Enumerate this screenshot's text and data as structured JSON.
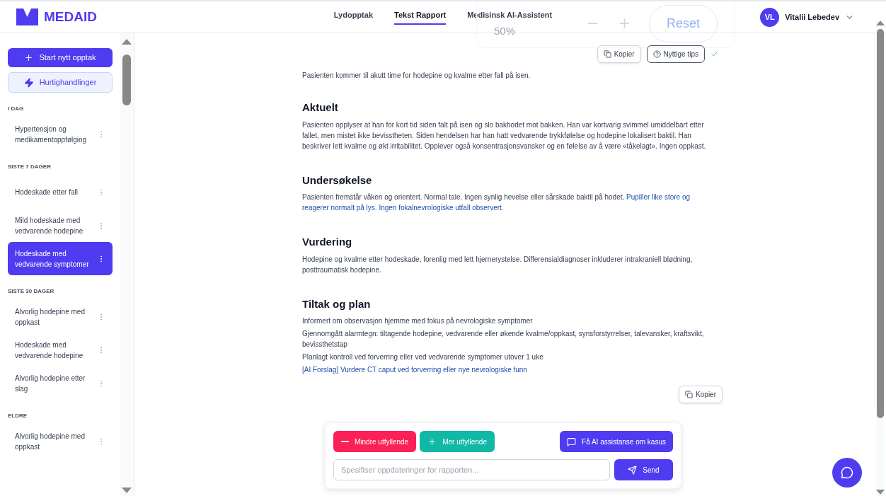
{
  "brand": {
    "name": "MEDAID"
  },
  "nav": [
    {
      "label": "Lydopptak",
      "selected": false
    },
    {
      "label": "Tekst Rapport",
      "selected": true
    },
    {
      "label": "Medisinsk AI-Assistent",
      "selected": false
    }
  ],
  "zoom_popup": {
    "value": "50%",
    "reset": "Reset"
  },
  "user": {
    "initials": "VL",
    "name": "Vitalii Lebedev"
  },
  "sidebar": {
    "primary_button": "Start nytt opptak",
    "quick_button": "Hurtighandlinger",
    "groups": [
      {
        "title": "I DAG",
        "items": [
          {
            "label": "Hypertensjon og medikamentoppfølging",
            "selected": false
          }
        ]
      },
      {
        "title": "SISTE 7 DAGER",
        "items": [
          {
            "label": "Hodeskade etter fall",
            "selected": false
          },
          {
            "label": "Mild hodeskade med vedvarende hodepine",
            "selected": false
          },
          {
            "label": "Hodeskade med vedvarende symptomer",
            "selected": true
          }
        ]
      },
      {
        "title": "SISTE 30 DAGER",
        "items": [
          {
            "label": "Alvorlig hodepine med oppkast",
            "selected": false
          },
          {
            "label": "Hodeskade med vedvarende hodepine",
            "selected": false
          },
          {
            "label": "Alvorlig hodepine etter slag",
            "selected": false
          }
        ]
      },
      {
        "title": "ELDRE",
        "items": [
          {
            "label": "Alvorlig hodepine med oppkast",
            "selected": false
          }
        ]
      }
    ]
  },
  "report": {
    "toolbar": {
      "copy": "Kopier",
      "tips": "Nyttige tips",
      "saved": true
    },
    "intro": [
      {
        "text": "Pasienten kommer til akutt time for hodepine og kvalme etter fall på isen.",
        "ai": false
      }
    ],
    "sections": [
      {
        "heading": "Aktuelt",
        "paragraphs": [
          [
            {
              "text": "Pasienten opplyser at han for kort tid siden falt på isen og slo bakhodet mot bakken. Han var kortvarig svimmel umiddelbart etter fallet, men mistet ikke bevisstheten. Siden hendelsen har han hatt vedvarende trykkfølelse og hodepine lokalisert baktil. Han beskriver lett kvalme og økt irritabilitet. Opplever også konsentrasjonsvansker og en følelse av å være «tåkelagt». Ingen oppkast.",
              "ai": false
            }
          ]
        ]
      },
      {
        "heading": "Undersøkelse",
        "paragraphs": [
          [
            {
              "text": "Pasienten fremstår våken og orientert. Normal tale. Ingen synlig hevelse eller sårskade baktil på hodet. ",
              "ai": false
            },
            {
              "text": "Pupiller like store og reagerer normalt på lys. Ingen fokalnevrologiske utfall observert.",
              "ai": true
            }
          ]
        ]
      },
      {
        "heading": "Vurdering",
        "paragraphs": [
          [
            {
              "text": "Hodepine og kvalme etter hodeskade, forenlig med lett hjernerystelse. Differensialdiagnoser inkluderer intrakraniell blødning, posttraumatisk hodepine.",
              "ai": false
            }
          ]
        ]
      },
      {
        "heading": "Tiltak og plan",
        "paragraphs": [
          [
            {
              "text": "Informert om observasjon hjemme med fokus på nevrologiske symptomer",
              "ai": false
            }
          ],
          [
            {
              "text": "Gjennomgått alarmtegn: tiltagende hodepine, vedvarende eller økende kvalme/oppkast, synsforstyrrelser, talevansker, kraftsvikt, bevissthetstap",
              "ai": false
            }
          ],
          [
            {
              "text": "Planlagt kontroll ved forverring eller ved vedvarende symptomer utover 1 uke",
              "ai": false
            }
          ],
          [
            {
              "text": "[AI Forslag] Vurdere CT caput ved forverring eller nye nevrologiske funn",
              "ai": true
            }
          ]
        ]
      }
    ],
    "bottom_copy": "Kopier"
  },
  "composer": {
    "less_button": "Mindre utfyllende",
    "more_button": "Mer utfyllende",
    "ai_button": "Få AI assistanse om kasus",
    "placeholder": "Spesifiser oppdateringer for rapporten...",
    "send_button": "Send"
  }
}
